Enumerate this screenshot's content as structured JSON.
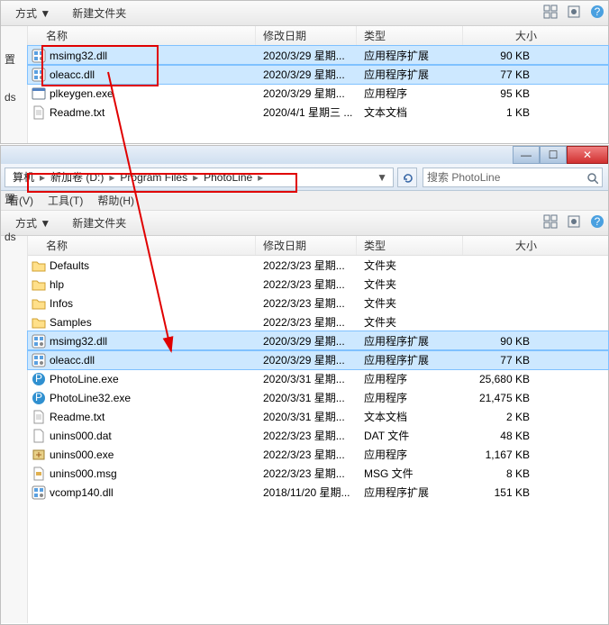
{
  "top": {
    "toolbar": {
      "mode": "方式 ▼",
      "newfolder": "新建文件夹"
    },
    "columns": {
      "name": "名称",
      "date": "修改日期",
      "type": "类型",
      "size": "大小"
    },
    "sideSettings": "置",
    "sideDownloads": "ds",
    "files": [
      {
        "icon": "dll",
        "name": "msimg32.dll",
        "date": "2020/3/29 星期...",
        "type": "应用程序扩展",
        "size": "90 KB",
        "sel": true
      },
      {
        "icon": "dll",
        "name": "oleacc.dll",
        "date": "2020/3/29 星期...",
        "type": "应用程序扩展",
        "size": "77 KB",
        "sel": true
      },
      {
        "icon": "exe",
        "name": "plkeygen.exe",
        "date": "2020/3/29 星期...",
        "type": "应用程序",
        "size": "95 KB",
        "sel": false
      },
      {
        "icon": "txt",
        "name": "Readme.txt",
        "date": "2020/4/1 星期三 ...",
        "type": "文本文档",
        "size": "1 KB",
        "sel": false
      }
    ]
  },
  "bottom": {
    "breadcrumb": {
      "seg1": "算机",
      "seg2": "新加卷 (D:)",
      "seg3": "Program Files",
      "seg4": "PhotoLine"
    },
    "addressDrop": "▼",
    "refreshLabel": "↻",
    "search": {
      "placeholder": "搜索 PhotoLine",
      "icon": "🔍"
    },
    "menu": {
      "view": "看(V)",
      "tools": "工具(T)",
      "help": "帮助(H)"
    },
    "toolbar": {
      "mode": "方式 ▼",
      "newfolder": "新建文件夹"
    },
    "columns": {
      "name": "名称",
      "date": "修改日期",
      "type": "类型",
      "size": "大小"
    },
    "sideSettings": "置",
    "sideDownloads": "ds",
    "files": [
      {
        "icon": "folder",
        "name": "Defaults",
        "date": "2022/3/23 星期...",
        "type": "文件夹",
        "size": "",
        "sel": false
      },
      {
        "icon": "folder",
        "name": "hlp",
        "date": "2022/3/23 星期...",
        "type": "文件夹",
        "size": "",
        "sel": false
      },
      {
        "icon": "folder",
        "name": "Infos",
        "date": "2022/3/23 星期...",
        "type": "文件夹",
        "size": "",
        "sel": false
      },
      {
        "icon": "folder",
        "name": "Samples",
        "date": "2022/3/23 星期...",
        "type": "文件夹",
        "size": "",
        "sel": false
      },
      {
        "icon": "dll",
        "name": "msimg32.dll",
        "date": "2020/3/29 星期...",
        "type": "应用程序扩展",
        "size": "90 KB",
        "sel": true
      },
      {
        "icon": "dll",
        "name": "oleacc.dll",
        "date": "2020/3/29 星期...",
        "type": "应用程序扩展",
        "size": "77 KB",
        "sel": true
      },
      {
        "icon": "pl",
        "name": "PhotoLine.exe",
        "date": "2020/3/31 星期...",
        "type": "应用程序",
        "size": "25,680 KB",
        "sel": false
      },
      {
        "icon": "pl",
        "name": "PhotoLine32.exe",
        "date": "2020/3/31 星期...",
        "type": "应用程序",
        "size": "21,475 KB",
        "sel": false
      },
      {
        "icon": "txt",
        "name": "Readme.txt",
        "date": "2020/3/31 星期...",
        "type": "文本文档",
        "size": "2 KB",
        "sel": false
      },
      {
        "icon": "dat",
        "name": "unins000.dat",
        "date": "2022/3/23 星期...",
        "type": "DAT 文件",
        "size": "48 KB",
        "sel": false
      },
      {
        "icon": "uninst",
        "name": "unins000.exe",
        "date": "2022/3/23 星期...",
        "type": "应用程序",
        "size": "1,167 KB",
        "sel": false
      },
      {
        "icon": "msg",
        "name": "unins000.msg",
        "date": "2022/3/23 星期...",
        "type": "MSG 文件",
        "size": "8 KB",
        "sel": false
      },
      {
        "icon": "dll",
        "name": "vcomp140.dll",
        "date": "2018/11/20 星期...",
        "type": "应用程序扩展",
        "size": "151 KB",
        "sel": false
      }
    ]
  },
  "winbuttons": {
    "min": "—",
    "max": "☐",
    "close": "✕"
  }
}
